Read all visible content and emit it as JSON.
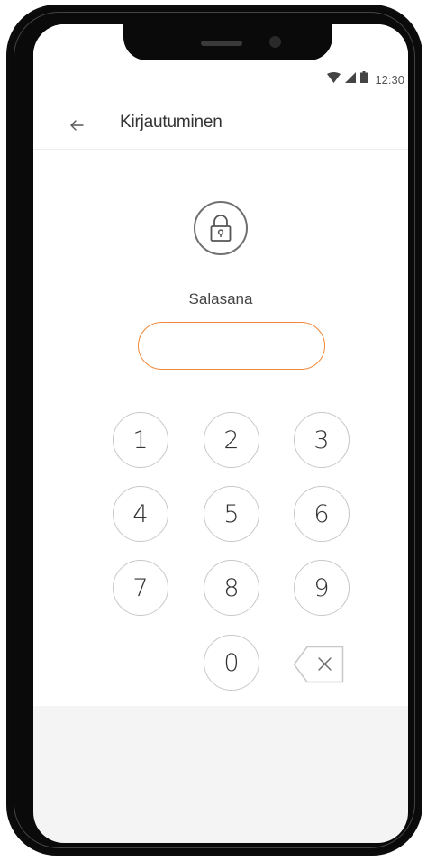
{
  "status_bar": {
    "time": "12:30",
    "icons": [
      "wifi-icon",
      "cellular-signal-icon",
      "battery-icon"
    ]
  },
  "header": {
    "back_icon": "back-arrow-icon",
    "title": "Kirjautuminen"
  },
  "lock": {
    "icon": "padlock-icon"
  },
  "password": {
    "label": "Salasana",
    "value": "",
    "placeholder": ""
  },
  "keypad": {
    "keys": [
      "1",
      "2",
      "3",
      "4",
      "5",
      "6",
      "7",
      "8",
      "9",
      "0"
    ],
    "backspace_icon": "backspace-icon"
  },
  "colors": {
    "accent": "#ef8a3d",
    "key_border": "#c8c8c8",
    "text": "#333333",
    "lower_panel": "#f4f4f4",
    "frame": "#0a0a0a"
  }
}
